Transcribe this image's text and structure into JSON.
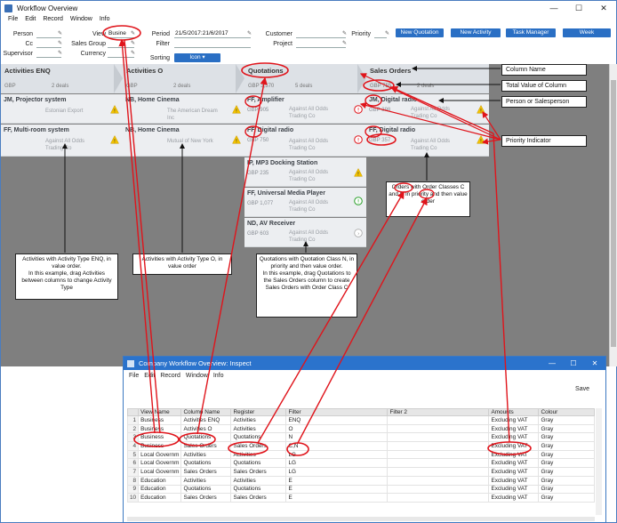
{
  "window": {
    "title": "Workflow Overview",
    "min": "—",
    "max": "☐",
    "close": "✕"
  },
  "menu": [
    "File",
    "Edit",
    "Record",
    "Window",
    "Info"
  ],
  "filters": {
    "person_label": "Person",
    "cc_label": "Cc",
    "supervisor_label": "Supervisor",
    "view_label": "View",
    "view_value": "Busine",
    "sales_group_label": "Sales Group",
    "currency_label": "Currency",
    "period_label": "Period",
    "period_value": "21/5/2017:21/6/2017",
    "filter_label": "Filter",
    "customer_label": "Customer",
    "project_label": "Project",
    "priority_label": "Priority",
    "sorting_label": "Sorting",
    "sorting_value": "Icon"
  },
  "buttons": {
    "new_quotation": "New Quotation",
    "new_activity": "New Activity",
    "task_manager": "Task Manager",
    "week": "Week"
  },
  "columns": [
    {
      "name": "Activities ENQ",
      "total": "GBP",
      "count": "2 deals"
    },
    {
      "name": "Activities O",
      "total": "GBP",
      "count": "2 deals"
    },
    {
      "name": "Quotations",
      "total": "GBP 3,570",
      "count": "5 deals"
    },
    {
      "name": "Sales Orders",
      "total": "GBP 755",
      "count": "2 deals"
    }
  ],
  "cards": {
    "c1": {
      "title": "JM, Projector system",
      "value": "",
      "company": "Estonian Export"
    },
    "c2": {
      "title": "FF, Multi-room system",
      "value": "",
      "company": "Against All Odds",
      "company2": "Trading Co"
    },
    "c3": {
      "title": "NB, Home Cinema",
      "value": "",
      "company": "The American Dream",
      "company2": "Inc"
    },
    "c4": {
      "title": "NB, Home Cinema",
      "value": "",
      "company": "Mutual of New York"
    },
    "c5": {
      "title": "FF, Amplifier",
      "value": "GBP 905",
      "company": "Against All Odds",
      "company2": "Trading Co"
    },
    "c6": {
      "title": "FF, Digital radio",
      "value": "GBP 750",
      "company": "Against All Odds",
      "company2": "Trading Co"
    },
    "c7": {
      "title": "IP, MP3 Docking Station",
      "value": "GBP 235",
      "company": "Against All Odds",
      "company2": "Trading Co"
    },
    "c8": {
      "title": "FF, Universal Media Player",
      "value": "GBP 1,077",
      "company": "Against All Odds",
      "company2": "Trading Co"
    },
    "c9": {
      "title": "ND, AV Receiver",
      "value": "GBP 603",
      "company": "Against All Odds",
      "company2": "Trading Co"
    },
    "c10": {
      "title": "JM, Digital radio",
      "value": "GBP 398",
      "company": "Against All Odds",
      "company2": "Trading Co"
    },
    "c11": {
      "title": "FF, Digital radio",
      "value": "GBP 357",
      "company": "Against All Odds",
      "company2": "Trading Co"
    }
  },
  "legend": {
    "column_name": "Column Name",
    "total_value": "Total Value of Column",
    "person": "Person or Salesperson",
    "priority": "Priority Indicator"
  },
  "notes": {
    "enq": "Activities with Activity Type ENQ, in value order.\nIn this example, drag Activities between columns to change Activity Type",
    "o": "Activities with Activity Type O, in value order",
    "quot": "Quotations with Quotation Class N, in priority and then value order.\nIn this example, drag Quotations to the Sales Orders column to create Sales Orders with Order Class C",
    "orders": "Orders with Order Classes C and N in priority and then value order"
  },
  "inspect": {
    "title": "Company Workflow Overview: Inspect",
    "menu": [
      "File",
      "Edit",
      "Record",
      "Window",
      "Info"
    ],
    "save": "Save",
    "headers": [
      "",
      "View Name",
      "Column Name",
      "Register",
      "Filter",
      "Filter 2",
      "Amounts",
      "Colour"
    ],
    "rows": [
      [
        "1",
        "Business",
        "Activities ENQ",
        "Activities",
        "ENQ",
        "",
        "Excluding VAT",
        "Gray"
      ],
      [
        "2",
        "Business",
        "Activities O",
        "Activities",
        "O",
        "",
        "Excluding VAT",
        "Gray"
      ],
      [
        "3",
        "Business",
        "Quotations",
        "Quotations",
        "N",
        "",
        "Excluding VAT",
        "Gray"
      ],
      [
        "4",
        "Business",
        "Sales Orders",
        "Sales Orders",
        "C,N",
        "",
        "Excluding VAT",
        "Gray"
      ],
      [
        "5",
        "Local Governm",
        "Activities",
        "Activities",
        "LG",
        "",
        "Excluding VAT",
        "Gray"
      ],
      [
        "6",
        "Local Governm",
        "Quotations",
        "Quotations",
        "LG",
        "",
        "Excluding VAT",
        "Gray"
      ],
      [
        "7",
        "Local Governm",
        "Sales Orders",
        "Sales Orders",
        "LG",
        "",
        "Excluding VAT",
        "Gray"
      ],
      [
        "8",
        "Education",
        "Activities",
        "Activities",
        "E",
        "",
        "Excluding VAT",
        "Gray"
      ],
      [
        "9",
        "Education",
        "Quotations",
        "Quotations",
        "E",
        "",
        "Excluding VAT",
        "Gray"
      ],
      [
        "10",
        "Education",
        "Sales Orders",
        "Sales Orders",
        "E",
        "",
        "Excluding VAT",
        "Gray"
      ]
    ]
  },
  "colors": {
    "accent": "#2a6fc4",
    "annotation": "#e0141b",
    "board": "#7f7f7f",
    "warning": "#f2c200",
    "alert": "#e0141b",
    "ok": "#2aa02a"
  }
}
